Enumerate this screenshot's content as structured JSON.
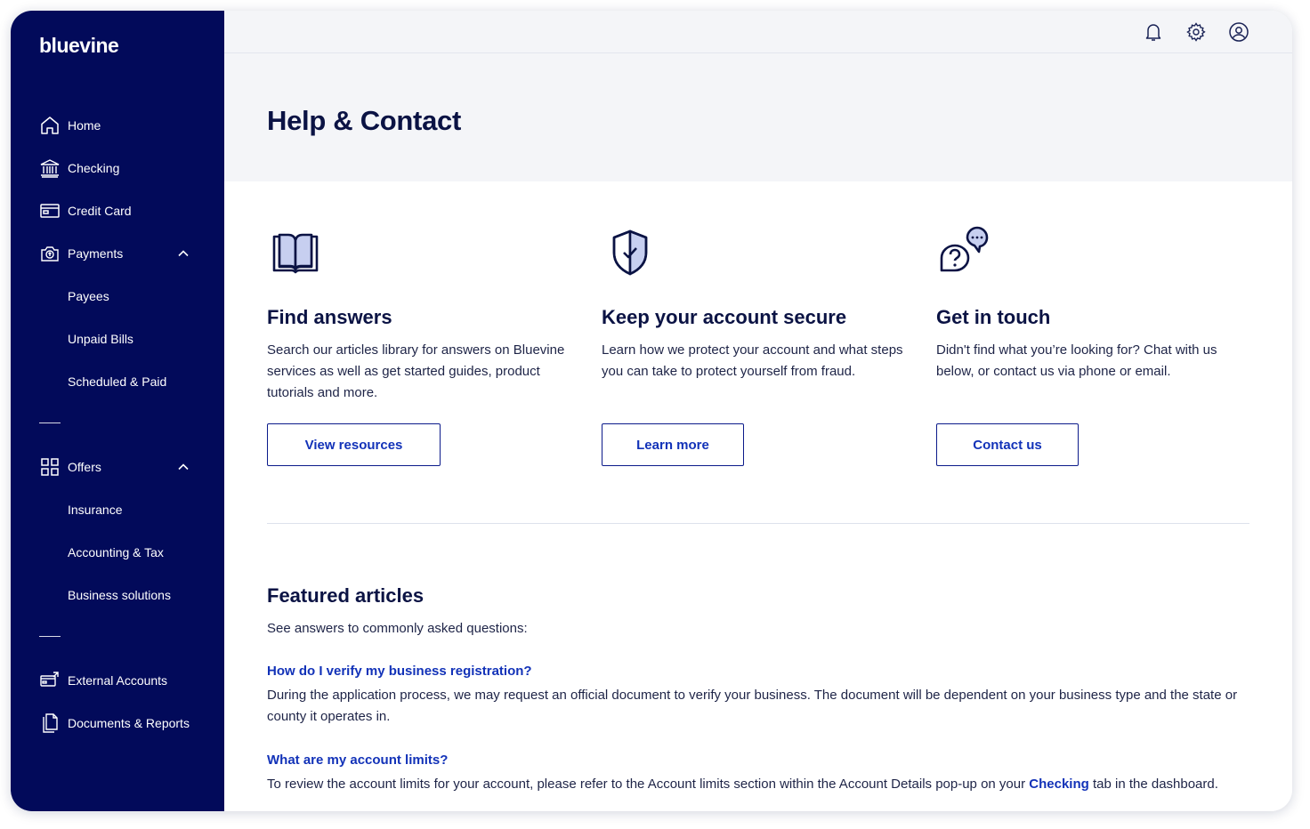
{
  "brand": {
    "logo_text": "bluevine",
    "sidebar_bg": "#020a5a",
    "accent": "#1232b8"
  },
  "sidebar": {
    "items": [
      {
        "label": "Home",
        "icon": "home-icon"
      },
      {
        "label": "Checking",
        "icon": "bank-icon"
      },
      {
        "label": "Credit Card",
        "icon": "credit-card-icon"
      },
      {
        "label": "Payments",
        "icon": "payments-icon",
        "expanded": true
      },
      {
        "label": "Payees"
      },
      {
        "label": "Unpaid Bills"
      },
      {
        "label": "Scheduled & Paid"
      },
      {
        "label": "Offers",
        "icon": "grid-icon",
        "expanded": true
      },
      {
        "label": "Insurance"
      },
      {
        "label": "Accounting & Tax"
      },
      {
        "label": "Business solutions"
      },
      {
        "label": "External Accounts",
        "icon": "external-accounts-icon"
      },
      {
        "label": "Documents & Reports",
        "icon": "documents-icon"
      }
    ]
  },
  "topbar": {
    "icons": [
      "bell-icon",
      "gear-icon",
      "user-icon"
    ]
  },
  "page": {
    "title": "Help & Contact"
  },
  "cards": [
    {
      "icon": "book-icon",
      "title": "Find answers",
      "body": "Search our articles library for answers on Bluevine services as well as get started guides, product tutorials and more.",
      "button": "View resources"
    },
    {
      "icon": "shield-check-icon",
      "title": "Keep your account secure",
      "body": "Learn how we protect your account and what steps you can take to protect yourself from fraud.",
      "button": "Learn more"
    },
    {
      "icon": "chat-question-icon",
      "title": "Get in touch",
      "body": "Didn't find what you’re looking for? Chat with us below, or contact us via phone or email.",
      "button": "Contact us"
    }
  ],
  "featured": {
    "title": "Featured articles",
    "subtitle": "See answers to commonly asked questions:",
    "articles": [
      {
        "question": "How do I verify my business registration?",
        "answer": "During the application process, we may request an official document to verify your business. The document will be dependent on your business type and the state or county it operates in."
      },
      {
        "question": "What are my account limits?",
        "answer_before": "To review the account limits for your account, please refer to the Account limits section within the Account Details pop-up on your ",
        "answer_link": "Checking",
        "answer_after": " tab in the dashboard."
      }
    ]
  }
}
